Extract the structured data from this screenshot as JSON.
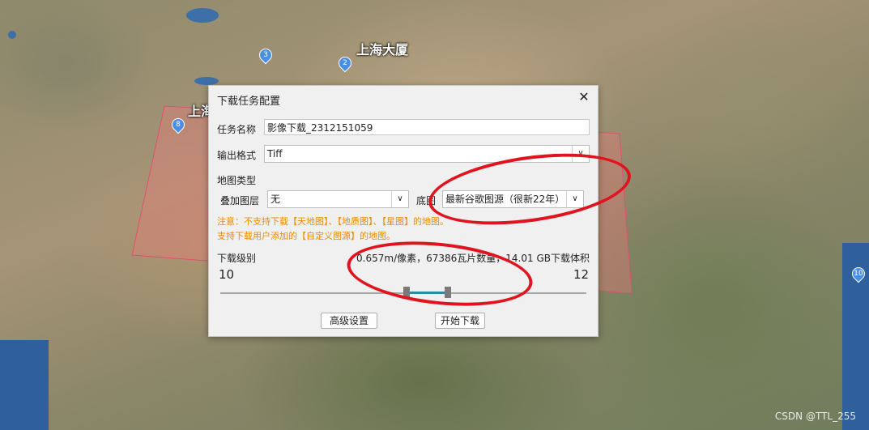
{
  "map": {
    "labels": [
      "上海大厦",
      "上海"
    ],
    "pins": [
      "3",
      "2",
      "8",
      "10"
    ],
    "watermark": "CSDN @TTL_255"
  },
  "dialog": {
    "title": "下载任务配置",
    "close_icon": "close-icon",
    "task_name_label": "任务名称",
    "task_name_value": "影像下载_2312151059",
    "output_format_label": "输出格式",
    "output_format_value": "Tiff",
    "map_type_label": "地图类型",
    "overlay_layer_label": "叠加图层",
    "overlay_layer_value": "无",
    "base_map_label": "底图",
    "base_map_value": "最新谷歌图源（很新22年）",
    "warning_line1": "注意：不支持下载【天地图】、【地质图】、【星图】的地图。",
    "warning_line2": "支持下载用户添加的【自定义图源】的地图。",
    "download_level_label": "下载级别",
    "download_info": "0.657m/像素，67386瓦片数量，14.01 GB下载体积",
    "level_min": "10",
    "level_max": "12",
    "advanced_button": "高级设置",
    "start_button": "开始下载"
  },
  "colors": {
    "annotation": "#e0141e",
    "warning": "#f08a00",
    "slider_range": "#2b8aa8"
  }
}
